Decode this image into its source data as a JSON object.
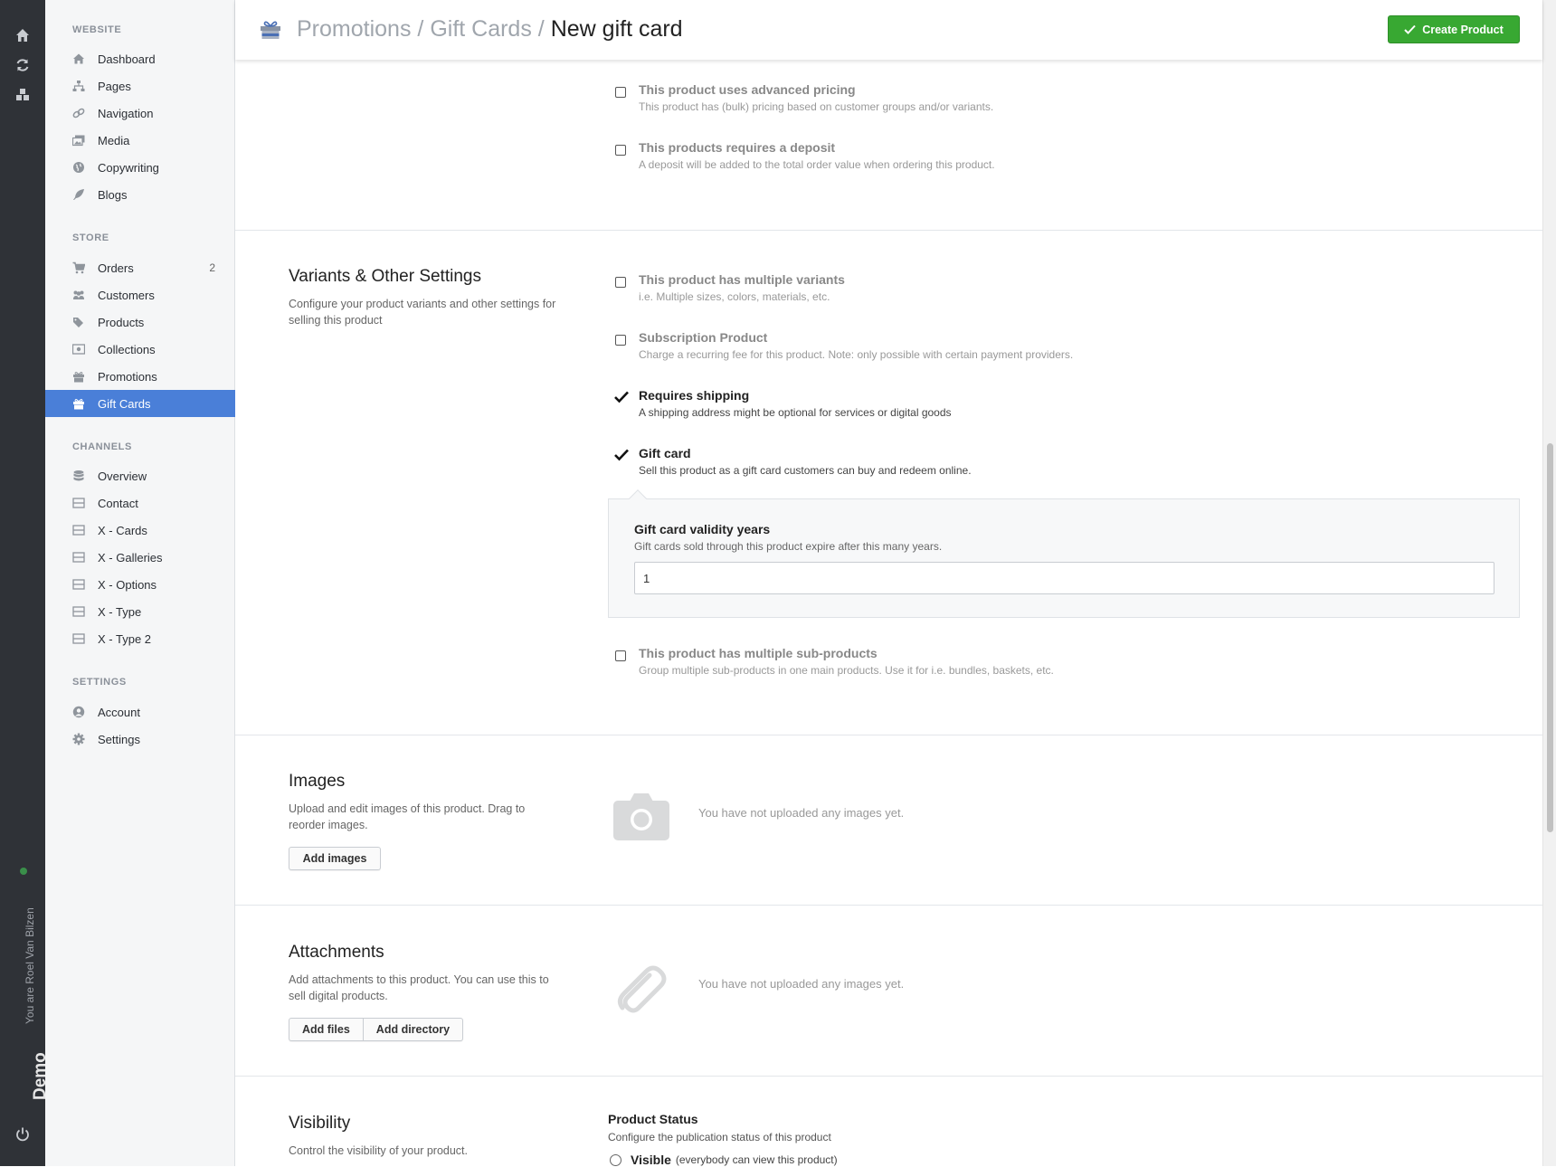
{
  "rail": {
    "user_label": "You are Roel Van Bilzen",
    "demo_label": "Demo"
  },
  "sidebar": {
    "sections": [
      {
        "label": "WEBSITE"
      },
      {
        "label": "STORE"
      },
      {
        "label": "CHANNELS"
      },
      {
        "label": "SETTINGS"
      }
    ],
    "items": [
      {
        "label": "Dashboard",
        "icon": "home-icon"
      },
      {
        "label": "Pages",
        "icon": "sitemap-icon"
      },
      {
        "label": "Navigation",
        "icon": "link-icon"
      },
      {
        "label": "Media",
        "icon": "images-icon"
      },
      {
        "label": "Copywriting",
        "icon": "globe-icon"
      },
      {
        "label": "Blogs",
        "icon": "feather-icon"
      },
      {
        "label": "Orders",
        "icon": "cart-icon",
        "badge": "2"
      },
      {
        "label": "Customers",
        "icon": "users-icon"
      },
      {
        "label": "Products",
        "icon": "tags-icon"
      },
      {
        "label": "Collections",
        "icon": "collection-icon"
      },
      {
        "label": "Promotions",
        "icon": "gift-icon"
      },
      {
        "label": "Gift Cards",
        "icon": "gift-icon",
        "active": true
      },
      {
        "label": "Overview",
        "icon": "database-icon"
      },
      {
        "label": "Contact",
        "icon": "window-icon"
      },
      {
        "label": "X - Cards",
        "icon": "window-icon"
      },
      {
        "label": "X - Galleries",
        "icon": "window-icon"
      },
      {
        "label": "X - Options",
        "icon": "window-icon"
      },
      {
        "label": "X - Type",
        "icon": "window-icon"
      },
      {
        "label": "X - Type 2",
        "icon": "window-icon"
      },
      {
        "label": "Account",
        "icon": "user-circle-icon"
      },
      {
        "label": "Settings",
        "icon": "gear-icon"
      }
    ]
  },
  "header": {
    "crumb_1": "Promotions",
    "crumb_2": "Gift Cards",
    "separator": "/",
    "current": "New gift card",
    "create_label": "Create Product"
  },
  "pricing": {
    "advanced_title": "This product uses advanced pricing",
    "advanced_sub": "This product has (bulk) pricing based on customer groups and/or variants.",
    "deposit_title": "This products requires a deposit",
    "deposit_sub": "A deposit will be added to the total order value when ordering this product."
  },
  "variants": {
    "title": "Variants & Other Settings",
    "desc": "Configure your product variants and other settings for selling this product",
    "options": [
      {
        "title": "This product has multiple variants",
        "sub": "i.e. Multiple sizes, colors, materials, etc.",
        "checked": false
      },
      {
        "title": "Subscription Product",
        "sub": "Charge a recurring fee for this product. Note: only possible with certain payment providers.",
        "checked": false
      },
      {
        "title": "Requires shipping",
        "sub": "A shipping address might be optional for services or digital goods",
        "checked": true
      },
      {
        "title": "Gift card",
        "sub": "Sell this product as a gift card customers can buy and redeem online.",
        "checked": true
      },
      {
        "title": "This product has multiple sub-products",
        "sub": "Group multiple sub-products in one main products. Use it for i.e. bundles, baskets, etc.",
        "checked": false
      }
    ],
    "validity": {
      "title": "Gift card validity years",
      "sub": "Gift cards sold through this product expire after this many years.",
      "value": "1"
    }
  },
  "images": {
    "title": "Images",
    "desc": "Upload and edit images of this product. Drag to reorder images.",
    "button": "Add images",
    "empty": "You have not uploaded any images yet."
  },
  "attachments": {
    "title": "Attachments",
    "desc": "Add attachments to this product. You can use this to sell digital products.",
    "button_files": "Add files",
    "button_directory": "Add directory",
    "empty": "You have not uploaded any images yet."
  },
  "visibility": {
    "title": "Visibility",
    "desc": "Control the visibility of your product.",
    "status_title": "Product Status",
    "status_desc": "Configure the publication status of this product",
    "option_label": "Visible",
    "option_note": "(everybody can view this product)"
  },
  "colors": {
    "accent": "#4a7fd8",
    "create": "#38a832",
    "rail": "#2f3237"
  }
}
